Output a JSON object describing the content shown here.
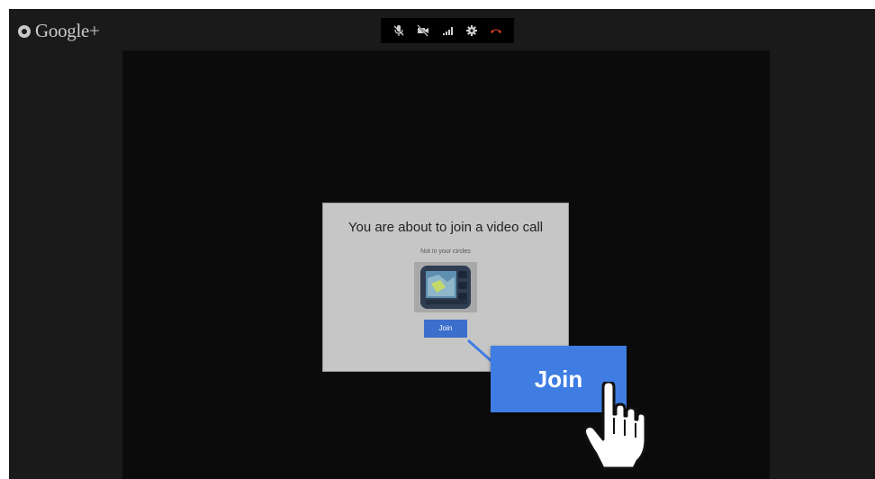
{
  "app": {
    "logo_text": "Google+",
    "logo_icon": "google-plus-icon"
  },
  "toolbar": {
    "buttons": [
      {
        "name": "mute-mic-icon",
        "label": "mute microphone"
      },
      {
        "name": "camera-off-icon",
        "label": "turn off camera"
      },
      {
        "name": "signal-bars-icon",
        "label": "bandwidth"
      },
      {
        "name": "gear-icon",
        "label": "settings"
      },
      {
        "name": "hang-up-icon",
        "label": "end call"
      }
    ],
    "hang_up_color": "#e0402a"
  },
  "dialog": {
    "title": "You are about to join a video call",
    "subtitle": "Not in your circles",
    "join_label": "Join"
  },
  "callout": {
    "join_label": "Join",
    "accent": "#3f7de3",
    "pointer_icon": "hand-pointer-icon"
  }
}
